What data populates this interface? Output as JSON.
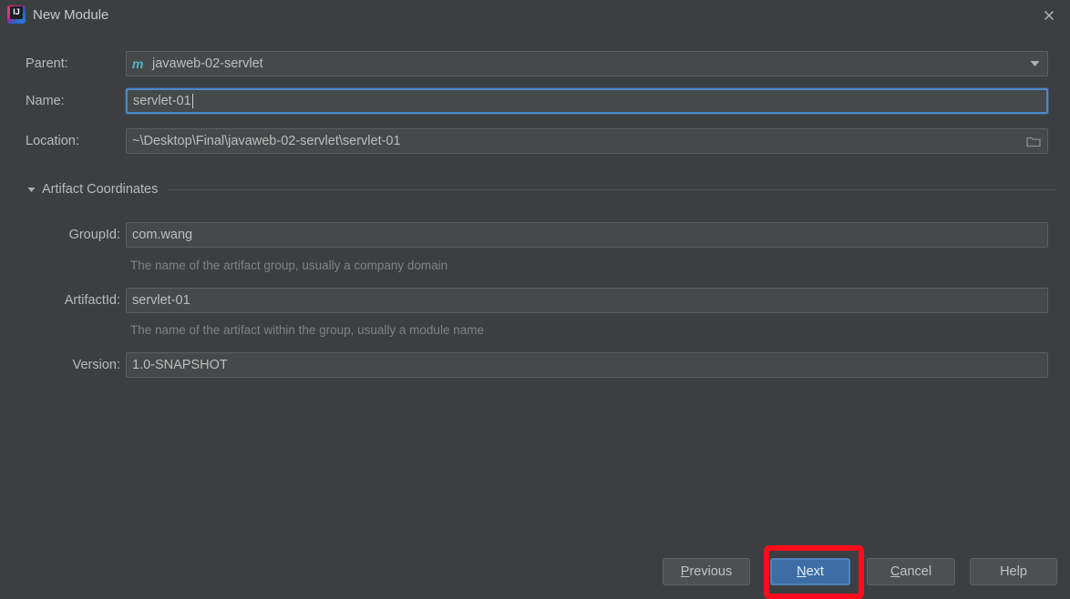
{
  "window": {
    "title": "New Module",
    "app_icon": "intellij-idea-icon",
    "close_icon": "close-icon",
    "background_color": "#3c3f41"
  },
  "form": {
    "parent": {
      "label": "Parent:",
      "value": "javaweb-02-servlet",
      "icon": "maven-module-icon",
      "icon_glyph": "m",
      "icon_color": "#52b5c4",
      "dropdown_icon": "chevron-down-icon"
    },
    "name": {
      "label": "Name:",
      "value": "servlet-01",
      "focused": true,
      "focus_color": "#4a88c7"
    },
    "location": {
      "label": "Location:",
      "value": "~\\Desktop\\Final\\javaweb-02-servlet\\servlet-01",
      "browse_icon": "folder-icon"
    }
  },
  "artifact_coordinates": {
    "section_label": "Artifact Coordinates",
    "expanded": true,
    "toggle_icon": "triangle-down-icon",
    "group_id": {
      "label": "GroupId:",
      "value": "com.wang",
      "hint": "The name of the artifact group, usually a company domain"
    },
    "artifact_id": {
      "label": "ArtifactId:",
      "value": "servlet-01",
      "hint": "The name of the artifact within the group, usually a module name"
    },
    "version": {
      "label": "Version:",
      "value": "1.0-SNAPSHOT"
    }
  },
  "buttons": {
    "previous": {
      "label": "Previous",
      "mnemonic": "P",
      "rest": "revious"
    },
    "next": {
      "label": "Next",
      "mnemonic": "N",
      "rest": "ext",
      "primary": true,
      "highlight_color": "#fc0d1b"
    },
    "cancel": {
      "label": "Cancel",
      "mnemonic": "C",
      "rest": "ancel"
    },
    "help": {
      "label": "Help"
    }
  }
}
